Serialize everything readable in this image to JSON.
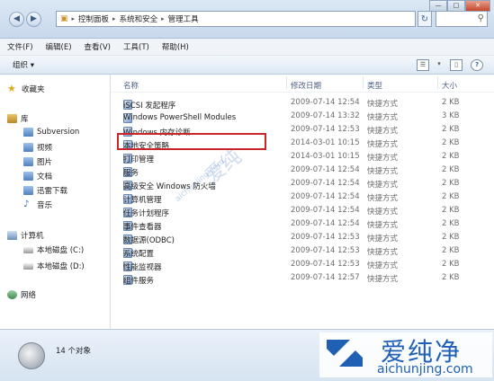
{
  "address": {
    "crumbs": [
      "控制面板",
      "系统和安全",
      "管理工具"
    ]
  },
  "window_buttons": {
    "minimize": "—",
    "maximize": "□",
    "close": "✕"
  },
  "menu": [
    "文件(F)",
    "编辑(E)",
    "查看(V)",
    "工具(T)",
    "帮助(H)"
  ],
  "toolbar": {
    "organize": "组织 ▾"
  },
  "sidebar": {
    "favorites": "收藏夹",
    "libraries": "库",
    "library_items": [
      "Subversion",
      "视频",
      "图片",
      "文档",
      "迅雷下载",
      "音乐"
    ],
    "computer": "计算机",
    "drives": [
      "本地磁盘 (C:)",
      "本地磁盘 (D:)"
    ],
    "network": "网络"
  },
  "columns": {
    "name": "名称",
    "date": "修改日期",
    "type": "类型",
    "size": "大小"
  },
  "files": [
    {
      "name": "iSCSI 发起程序",
      "date": "2009-07-14 12:54",
      "type": "快捷方式",
      "size": "2 KB"
    },
    {
      "name": "Windows PowerShell Modules",
      "date": "2009-07-14 13:32",
      "type": "快捷方式",
      "size": "3 KB"
    },
    {
      "name": "Windows 内存诊断",
      "date": "2009-07-14 12:53",
      "type": "快捷方式",
      "size": "2 KB"
    },
    {
      "name": "本地安全策略",
      "date": "2014-03-01 10:15",
      "type": "快捷方式",
      "size": "2 KB"
    },
    {
      "name": "打印管理",
      "date": "2014-03-01 10:15",
      "type": "快捷方式",
      "size": "2 KB"
    },
    {
      "name": "服务",
      "date": "2009-07-14 12:54",
      "type": "快捷方式",
      "size": "2 KB"
    },
    {
      "name": "高级安全 Windows 防火墙",
      "date": "2009-07-14 12:54",
      "type": "快捷方式",
      "size": "2 KB"
    },
    {
      "name": "计算机管理",
      "date": "2009-07-14 12:54",
      "type": "快捷方式",
      "size": "2 KB"
    },
    {
      "name": "任务计划程序",
      "date": "2009-07-14 12:54",
      "type": "快捷方式",
      "size": "2 KB"
    },
    {
      "name": "事件查看器",
      "date": "2009-07-14 12:54",
      "type": "快捷方式",
      "size": "2 KB"
    },
    {
      "name": "数据源(ODBC)",
      "date": "2009-07-14 12:53",
      "type": "快捷方式",
      "size": "2 KB"
    },
    {
      "name": "系统配置",
      "date": "2009-07-14 12:53",
      "type": "快捷方式",
      "size": "2 KB"
    },
    {
      "name": "性能监视器",
      "date": "2009-07-14 12:53",
      "type": "快捷方式",
      "size": "2 KB"
    },
    {
      "name": "组件服务",
      "date": "2009-07-14 12:57",
      "type": "快捷方式",
      "size": "2 KB"
    }
  ],
  "status": {
    "count": "14 个对象"
  },
  "watermark": {
    "brand": "爱纯净",
    "url": "aichunjing.com",
    "center_small": "aichunjing.com",
    "center_big": "爱纯"
  }
}
